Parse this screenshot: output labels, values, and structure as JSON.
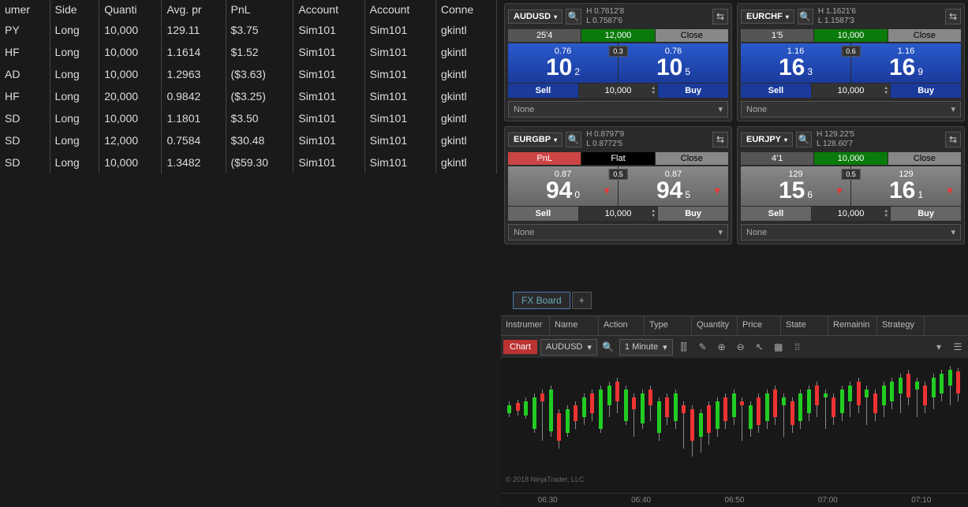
{
  "positions": {
    "headers": [
      "umer",
      "Side",
      "Quanti",
      "Avg. pr",
      "PnL",
      "Account",
      "Account",
      "Conne"
    ],
    "rows": [
      {
        "instr": "PY",
        "side": "Long",
        "qty": "10,000",
        "avg": "129.11",
        "pnl": "$3.75",
        "pnl_pos": true,
        "acc1": "Sim101",
        "acc2": "Sim101",
        "conn": "gkintl"
      },
      {
        "instr": "HF",
        "side": "Long",
        "qty": "10,000",
        "avg": "1.1614",
        "pnl": "$1.52",
        "pnl_pos": true,
        "acc1": "Sim101",
        "acc2": "Sim101",
        "conn": "gkintl"
      },
      {
        "instr": "AD",
        "side": "Long",
        "qty": "10,000",
        "avg": "1.2963",
        "pnl": "($3.63)",
        "pnl_pos": false,
        "acc1": "Sim101",
        "acc2": "Sim101",
        "conn": "gkintl"
      },
      {
        "instr": "HF",
        "side": "Long",
        "qty": "20,000",
        "avg": "0.9842",
        "pnl": "($3.25)",
        "pnl_pos": false,
        "acc1": "Sim101",
        "acc2": "Sim101",
        "conn": "gkintl"
      },
      {
        "instr": "SD",
        "side": "Long",
        "qty": "10,000",
        "avg": "1.1801",
        "pnl": "$3.50",
        "pnl_pos": true,
        "acc1": "Sim101",
        "acc2": "Sim101",
        "conn": "gkintl"
      },
      {
        "instr": "SD",
        "side": "Long",
        "qty": "12,000",
        "avg": "0.7584",
        "pnl": "$30.48",
        "pnl_pos": true,
        "acc1": "Sim101",
        "acc2": "Sim101",
        "conn": "gkintl"
      },
      {
        "instr": "SD",
        "side": "Long",
        "qty": "10,000",
        "avg": "1.3482",
        "pnl": "($59.30",
        "pnl_pos": false,
        "acc1": "Sim101",
        "acc2": "Sim101",
        "conn": "gkintl"
      }
    ]
  },
  "tiles": [
    {
      "sym": "AUDUSD",
      "hi": "H  0.7612'8",
      "lo": "L  0.7587'6",
      "r1a": "25'4",
      "r1a_cls": "r1-gray",
      "r1b": "12,000",
      "r1b_cls": "r1-green",
      "r1c": "Close",
      "r1c_cls": "r1-close",
      "handle": "0.76",
      "big_l": "10",
      "sub_l": "2",
      "big_r": "10",
      "sub_r": "5",
      "spread": "0.3",
      "px_cls": "px-blue",
      "sb_cls": "sb-blue",
      "qty": "10,000",
      "none": "None",
      "arrows": false
    },
    {
      "sym": "EURCHF",
      "hi": "H  1.1621'6",
      "lo": "L  1.1587'3",
      "r1a": "1'5",
      "r1a_cls": "r1-gray",
      "r1b": "10,000",
      "r1b_cls": "r1-green",
      "r1c": "Close",
      "r1c_cls": "r1-close",
      "handle": "1.16",
      "big_l": "16",
      "sub_l": "3",
      "big_r": "16",
      "sub_r": "9",
      "spread": "0.6",
      "px_cls": "px-blue",
      "sb_cls": "sb-blue",
      "qty": "10,000",
      "none": "None",
      "arrows": false
    },
    {
      "sym": "EURGBP",
      "hi": "H  0.8797'9",
      "lo": "L  0.8772'5",
      "r1a": "PnL",
      "r1a_cls": "r1-red",
      "r1b": "Flat",
      "r1b_cls": "r1-flat",
      "r1c": "Close",
      "r1c_cls": "r1-close",
      "handle": "0.87",
      "big_l": "94",
      "sub_l": "0",
      "big_r": "94",
      "sub_r": "5",
      "spread": "0.5",
      "px_cls": "px-gray",
      "sb_cls": "sb-gray",
      "qty": "10,000",
      "none": "None",
      "arrows": true
    },
    {
      "sym": "EURJPY",
      "hi": "H  129.22'5",
      "lo": "L  128.60'7",
      "r1a": "4'1",
      "r1a_cls": "r1-gray",
      "r1b": "10,000",
      "r1b_cls": "r1-green",
      "r1c": "Close",
      "r1c_cls": "r1-close",
      "handle": "129",
      "big_l": "15",
      "sub_l": "6",
      "big_r": "16",
      "sub_r": "1",
      "spread": "0.5",
      "px_cls": "px-gray",
      "sb_cls": "sb-gray",
      "qty": "10,000",
      "none": "None",
      "arrows": true
    }
  ],
  "labels": {
    "sell": "Sell",
    "buy": "Buy",
    "fx_board": "FX Board",
    "plus": "+"
  },
  "orders_headers": [
    "Instrumer",
    "Name",
    "Action",
    "Type",
    "Quantity",
    "Price",
    "State",
    "Remainin",
    "Strategy"
  ],
  "chart": {
    "btn": "Chart",
    "sym": "AUDUSD",
    "interval": "1 Minute",
    "copyright": "© 2018 NinjaTrader, LLC",
    "xticks": [
      "06:30",
      "06:40",
      "06:50",
      "07:00",
      "07:10"
    ]
  },
  "chart_data": {
    "type": "candlestick",
    "interval": "1 Minute",
    "symbol": "AUDUSD",
    "x_range": [
      "06:25",
      "07:18"
    ],
    "candles_approx_count": 55,
    "note": "visual candlestick approximation; exact OHLC not labeled on image"
  }
}
